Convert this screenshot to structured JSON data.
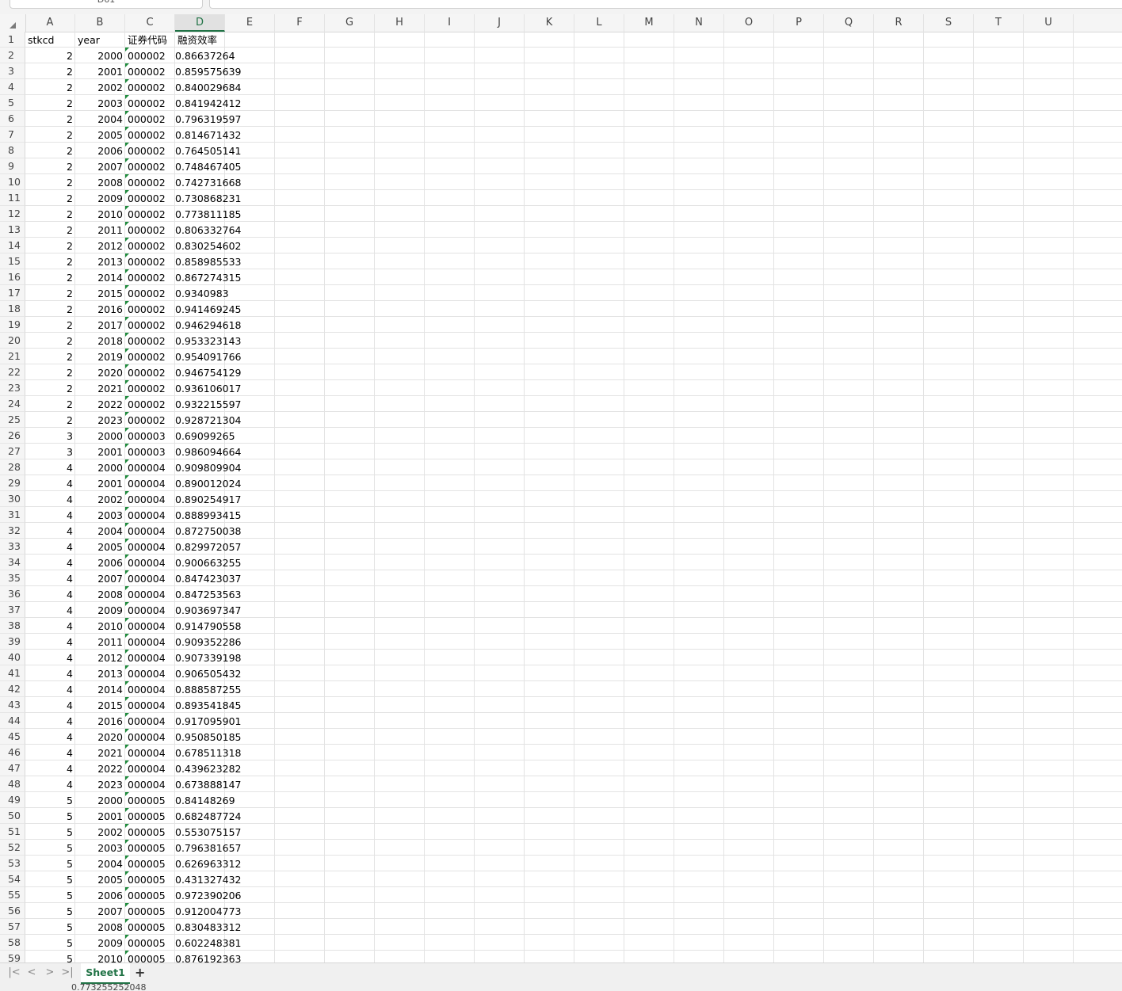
{
  "namebox": {
    "value": "D61"
  },
  "formula_bar": {
    "fx_icon": "fx-icon",
    "value": ""
  },
  "columns": [
    "A",
    "B",
    "C",
    "D",
    "E",
    "F",
    "G",
    "H",
    "I",
    "J",
    "K",
    "L",
    "M",
    "N",
    "O",
    "P",
    "Q",
    "R",
    "S",
    "T",
    "U"
  ],
  "selected_column": "D",
  "header_row": {
    "A": "stkcd",
    "B": "year",
    "C": "证券代码",
    "D": "融资效率"
  },
  "rows": [
    [
      2,
      2000,
      "000002",
      "0.86637264"
    ],
    [
      2,
      2001,
      "000002",
      "0.859575639"
    ],
    [
      2,
      2002,
      "000002",
      "0.840029684"
    ],
    [
      2,
      2003,
      "000002",
      "0.841942412"
    ],
    [
      2,
      2004,
      "000002",
      "0.796319597"
    ],
    [
      2,
      2005,
      "000002",
      "0.814671432"
    ],
    [
      2,
      2006,
      "000002",
      "0.764505141"
    ],
    [
      2,
      2007,
      "000002",
      "0.748467405"
    ],
    [
      2,
      2008,
      "000002",
      "0.742731668"
    ],
    [
      2,
      2009,
      "000002",
      "0.730868231"
    ],
    [
      2,
      2010,
      "000002",
      "0.773811185"
    ],
    [
      2,
      2011,
      "000002",
      "0.806332764"
    ],
    [
      2,
      2012,
      "000002",
      "0.830254602"
    ],
    [
      2,
      2013,
      "000002",
      "0.858985533"
    ],
    [
      2,
      2014,
      "000002",
      "0.867274315"
    ],
    [
      2,
      2015,
      "000002",
      "0.9340983"
    ],
    [
      2,
      2016,
      "000002",
      "0.941469245"
    ],
    [
      2,
      2017,
      "000002",
      "0.946294618"
    ],
    [
      2,
      2018,
      "000002",
      "0.953323143"
    ],
    [
      2,
      2019,
      "000002",
      "0.954091766"
    ],
    [
      2,
      2020,
      "000002",
      "0.946754129"
    ],
    [
      2,
      2021,
      "000002",
      "0.936106017"
    ],
    [
      2,
      2022,
      "000002",
      "0.932215597"
    ],
    [
      2,
      2023,
      "000002",
      "0.928721304"
    ],
    [
      3,
      2000,
      "000003",
      "0.69099265"
    ],
    [
      3,
      2001,
      "000003",
      "0.986094664"
    ],
    [
      4,
      2000,
      "000004",
      "0.909809904"
    ],
    [
      4,
      2001,
      "000004",
      "0.890012024"
    ],
    [
      4,
      2002,
      "000004",
      "0.890254917"
    ],
    [
      4,
      2003,
      "000004",
      "0.888993415"
    ],
    [
      4,
      2004,
      "000004",
      "0.872750038"
    ],
    [
      4,
      2005,
      "000004",
      "0.829972057"
    ],
    [
      4,
      2006,
      "000004",
      "0.900663255"
    ],
    [
      4,
      2007,
      "000004",
      "0.847423037"
    ],
    [
      4,
      2008,
      "000004",
      "0.847253563"
    ],
    [
      4,
      2009,
      "000004",
      "0.903697347"
    ],
    [
      4,
      2010,
      "000004",
      "0.914790558"
    ],
    [
      4,
      2011,
      "000004",
      "0.909352286"
    ],
    [
      4,
      2012,
      "000004",
      "0.907339198"
    ],
    [
      4,
      2013,
      "000004",
      "0.906505432"
    ],
    [
      4,
      2014,
      "000004",
      "0.888587255"
    ],
    [
      4,
      2015,
      "000004",
      "0.893541845"
    ],
    [
      4,
      2016,
      "000004",
      "0.917095901"
    ],
    [
      4,
      2020,
      "000004",
      "0.950850185"
    ],
    [
      4,
      2021,
      "000004",
      "0.678511318"
    ],
    [
      4,
      2022,
      "000004",
      "0.439623282"
    ],
    [
      4,
      2023,
      "000004",
      "0.673888147"
    ],
    [
      5,
      2000,
      "000005",
      "0.84148269"
    ],
    [
      5,
      2001,
      "000005",
      "0.682487724"
    ],
    [
      5,
      2002,
      "000005",
      "0.553075157"
    ],
    [
      5,
      2003,
      "000005",
      "0.796381657"
    ],
    [
      5,
      2004,
      "000005",
      "0.626963312"
    ],
    [
      5,
      2005,
      "000005",
      "0.431327432"
    ],
    [
      5,
      2006,
      "000005",
      "0.972390206"
    ],
    [
      5,
      2007,
      "000005",
      "0.912004773"
    ],
    [
      5,
      2008,
      "000005",
      "0.830483312"
    ],
    [
      5,
      2009,
      "000005",
      "0.602248381"
    ],
    [
      5,
      2010,
      "000005",
      "0.876192363"
    ]
  ],
  "sheet_tabs": [
    {
      "label": "Sheet1",
      "active": true
    }
  ],
  "add_sheet_label": "+",
  "nav": {
    "first": "|<",
    "prev": "<",
    "next": ">",
    "last": ">|"
  },
  "status": {
    "value": "0.773255252048"
  },
  "colors": {
    "accent": "#217346",
    "comment_marker": "#1e8a3c"
  }
}
